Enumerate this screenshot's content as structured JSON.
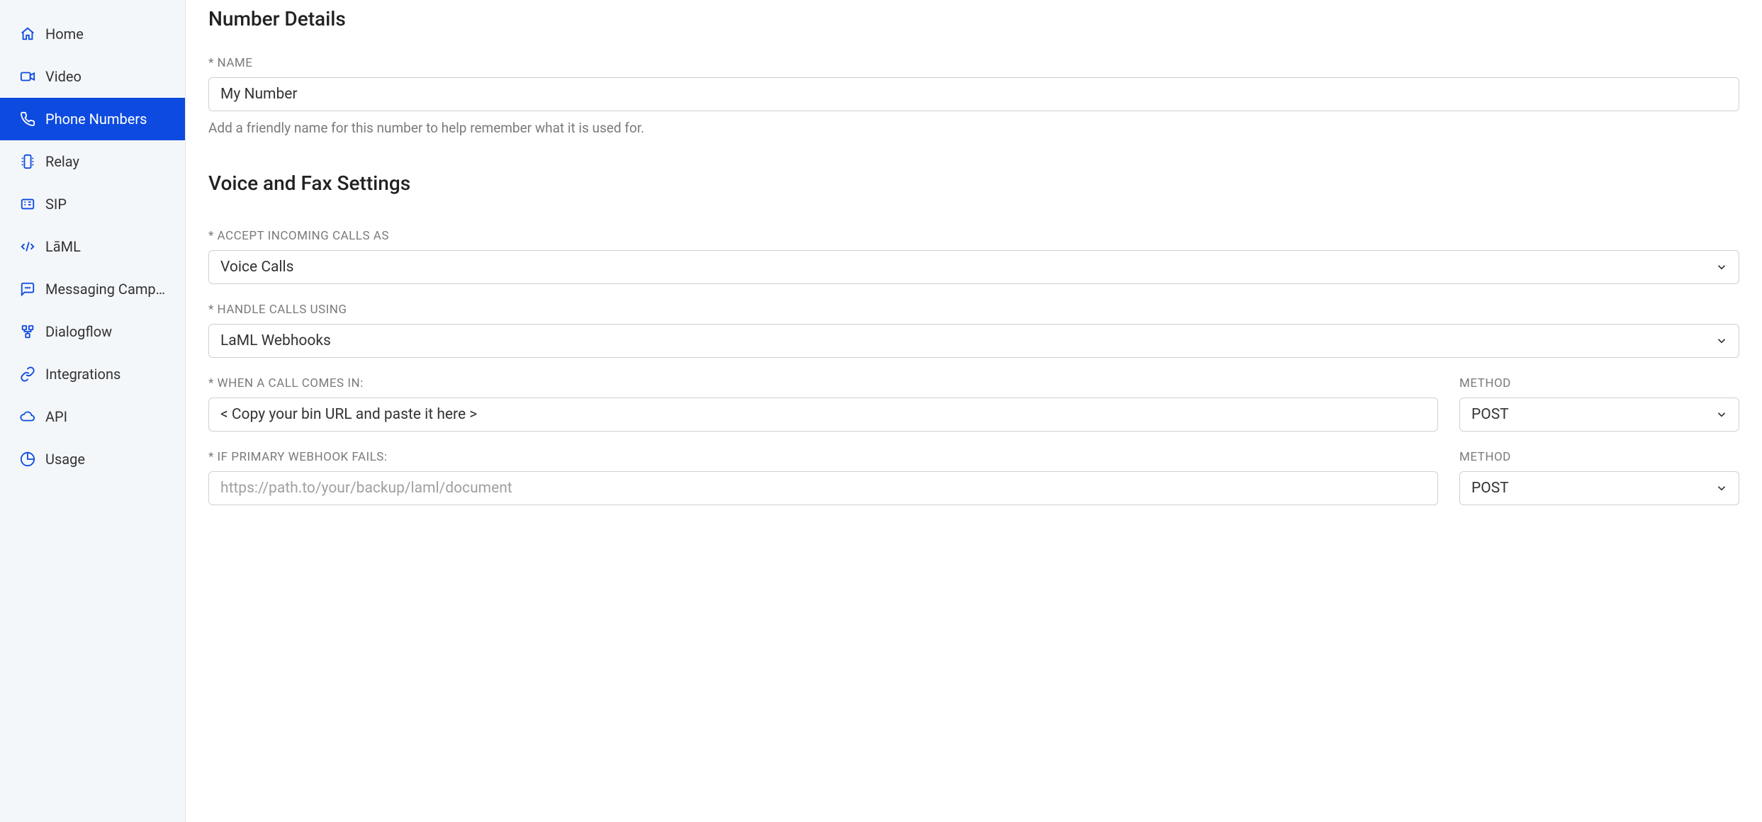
{
  "sidebar": {
    "items": [
      {
        "label": "Home"
      },
      {
        "label": "Video"
      },
      {
        "label": "Phone Numbers"
      },
      {
        "label": "Relay"
      },
      {
        "label": "SIP"
      },
      {
        "label": "LāML"
      },
      {
        "label": "Messaging Camp..."
      },
      {
        "label": "Dialogflow"
      },
      {
        "label": "Integrations"
      },
      {
        "label": "API"
      },
      {
        "label": "Usage"
      }
    ]
  },
  "sections": {
    "number_details": {
      "title": "Number Details",
      "name_label": "* NAME",
      "name_value": "My Number",
      "name_help": "Add a friendly name for this number to help remember what it is used for."
    },
    "voice_fax": {
      "title": "Voice and Fax Settings",
      "accept_label": "* ACCEPT INCOMING CALLS AS",
      "accept_value": "Voice Calls",
      "handle_label": "* HANDLE CALLS USING",
      "handle_value": "LaML Webhooks",
      "when_call_label": "* WHEN A CALL COMES IN:",
      "when_call_value": "< Copy your bin URL and paste it here >",
      "method_label": "METHOD",
      "method_value_1": "POST",
      "fallback_label": "* IF PRIMARY WEBHOOK FAILS:",
      "fallback_placeholder": "https://path.to/your/backup/laml/document",
      "method_value_2": "POST"
    }
  }
}
